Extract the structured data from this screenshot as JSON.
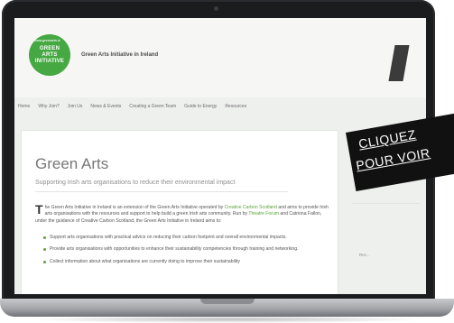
{
  "site": {
    "logo_url": "www.greenarts.ie",
    "logo_lines": [
      "GREEN",
      "ARTS",
      "INITIATIVE"
    ],
    "title": "Green Arts Initiative in Ireland"
  },
  "nav": {
    "items": [
      "Home",
      "Why Join?",
      "Join Us",
      "News & Events",
      "Creating a Green Team",
      "Guide to Energy",
      "Resources"
    ]
  },
  "page": {
    "title": "Green Arts",
    "subtitle": "Supporting Irish arts organisations to reduce their environmental impact",
    "intro": {
      "dropcap": "T",
      "part1": "he Green Arts Initiative in Ireland is an extension of the Green Arts Initiative operated by ",
      "link1": "Creative Carbon Scotland",
      "part2": " and aims to provide Irish arts organisations with the resources and support to help build a green Irish arts community. Run by ",
      "link2": "Theatre Forum",
      "part3": " and Catriona Fallon, under the guidance of Creative Carbon Scotland, the Green Arts Initiative in Ireland aims to:"
    },
    "list": [
      "Support arts organisations with practical advice on reducing their carbon footprint and overall environmental impacts.",
      "Provide arts organisations with opportunities to enhance their sustainability competencies through training and networking.",
      "Collect information about what organisations are currently doing to improve their sustainability"
    ]
  },
  "sidebar": {
    "item": "Rec..."
  },
  "banner": {
    "line1": "CLIQUEZ",
    "line2": "POUR VOIR"
  },
  "colors": {
    "brand_green": "#45a842",
    "link_green": "#5aa33b",
    "banner_bg": "#111111"
  }
}
